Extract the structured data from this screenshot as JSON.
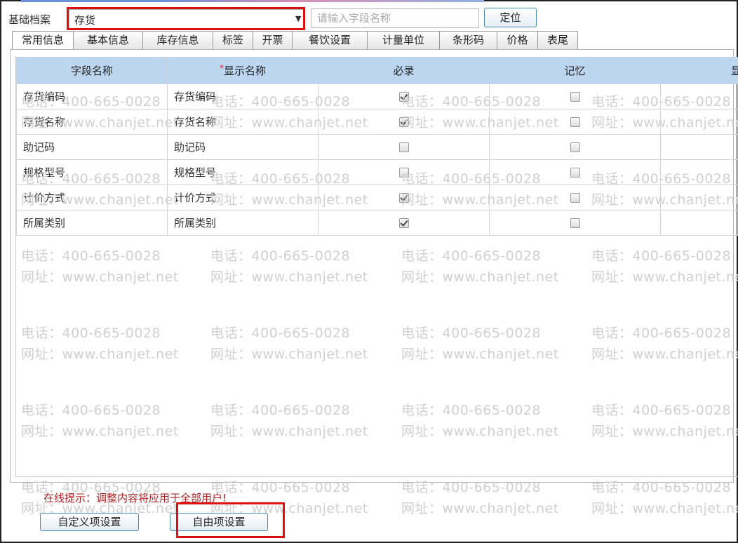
{
  "header": {
    "archive_label": "基础档案",
    "archive_value": "存货",
    "search_placeholder": "请输入字段名称",
    "locate_label": "定位"
  },
  "tabs": [
    {
      "label": "常用信息",
      "active": true
    },
    {
      "label": "基本信息",
      "active": false
    },
    {
      "label": "库存信息",
      "active": false
    },
    {
      "label": "标签",
      "active": false
    },
    {
      "label": "开票",
      "active": false
    },
    {
      "label": "餐饮设置",
      "active": false
    },
    {
      "label": "计量单位",
      "active": false
    },
    {
      "label": "条形码",
      "active": false
    },
    {
      "label": "价格",
      "active": false
    },
    {
      "label": "表尾",
      "active": false
    }
  ],
  "table": {
    "columns": [
      "字段名称",
      "显示名称",
      "必录",
      "记忆",
      "显"
    ],
    "required_marker": "*",
    "rows": [
      {
        "field": "存货编码",
        "display": "存货编码",
        "required": true,
        "remember": false
      },
      {
        "field": "存货名称",
        "display": "存货名称",
        "required": true,
        "remember": false
      },
      {
        "field": "助记码",
        "display": "助记码",
        "required": false,
        "remember": false
      },
      {
        "field": "规格型号",
        "display": "规格型号",
        "required": false,
        "remember": false
      },
      {
        "field": "计价方式",
        "display": "计价方式",
        "required": true,
        "remember": false
      },
      {
        "field": "所属类别",
        "display": "所属类别",
        "required": true,
        "remember": false
      }
    ]
  },
  "watermark": {
    "phone": "电话：400-665-0028",
    "site": "网址：www.chanjet.net"
  },
  "footer": {
    "hint": "在线提示：调整内容将应用于全部用户!",
    "custom_button": "自定义项设置",
    "free_button": "自由项设置"
  },
  "colors": {
    "header_bg": "#bcd6f0",
    "highlight_red": "#e01010",
    "hint_red": "#b02020"
  }
}
